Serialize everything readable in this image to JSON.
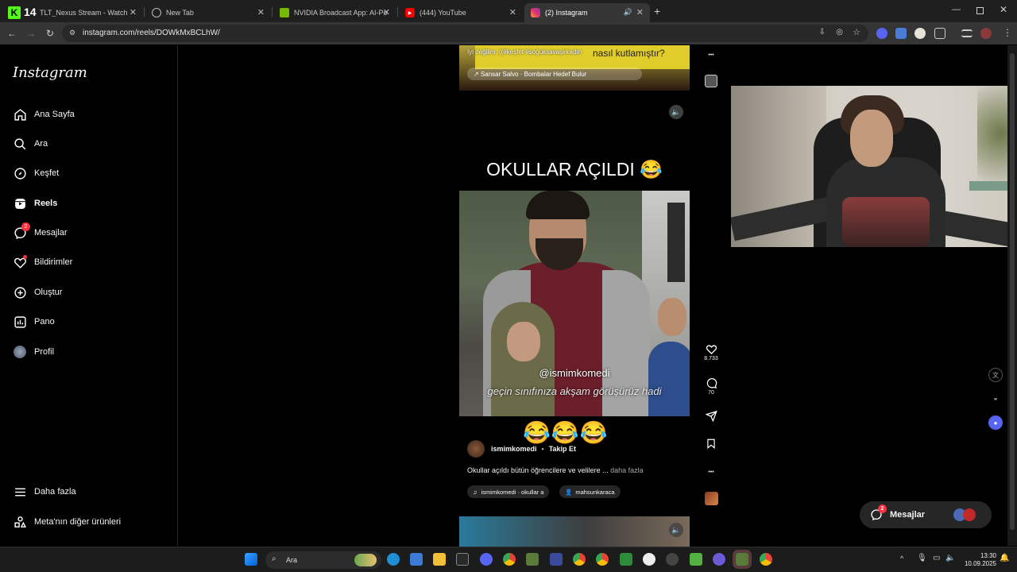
{
  "browser": {
    "tabs": [
      {
        "label": "TLT_Nexus Stream - Watch Li",
        "fav_text": "K",
        "fav_color": "#53fc18",
        "overlay_text": "14"
      },
      {
        "label": "New Tab"
      },
      {
        "label": "NVIDIA Broadcast App: AI-Pow",
        "fav_color": "#76b900"
      },
      {
        "label": "(444) YouTube",
        "fav_color": "#ff0000"
      },
      {
        "label": "(2) Instagram",
        "fav_color": "#e1306c"
      }
    ],
    "url": "instagram.com/reels/DOWkMxBCLhW/"
  },
  "sidebar": {
    "logo": "Instagram",
    "items": [
      {
        "label": "Ana Sayfa",
        "icon": "home-icon"
      },
      {
        "label": "Ara",
        "icon": "search-icon"
      },
      {
        "label": "Keşfet",
        "icon": "compass-icon"
      },
      {
        "label": "Reels",
        "icon": "reels-icon"
      },
      {
        "label": "Mesajlar",
        "icon": "messenger-icon",
        "badge": "2"
      },
      {
        "label": "Bildirimler",
        "icon": "heart-icon"
      },
      {
        "label": "Oluştur",
        "icon": "plus-square-icon"
      },
      {
        "label": "Pano",
        "icon": "dashboard-icon"
      },
      {
        "label": "Profil",
        "icon": "avatar"
      }
    ],
    "more": "Daha fazla",
    "meta": "Meta'nın diğer ürünleri"
  },
  "reel_prev": {
    "caption": "İyi değilim :((#keşfet #soğuksavaş#kadın",
    "caption_right": "nasıl kutlamıştır?",
    "music": "↗ Sansar Salvo · Bombalar Hedef Bulur"
  },
  "reel": {
    "title": "OKULLAR AÇILDI 😂",
    "video_handle": "@ismimkomedi",
    "video_subtitle": "geçin sınıfınıza akşam görüşürüz hadi",
    "emoji": "😂😂😂",
    "author": "ismimkomedi",
    "follow": "Takip Et",
    "description": "Okullar açıldı bütün öğrencilere ve velilere ...",
    "more": "daha fazla",
    "audio_chip": "ismimkomedi · okullar a",
    "tag_chip": "mahsunkaraca"
  },
  "actions": {
    "likes": "8.733",
    "comments": "70"
  },
  "messages_pill": {
    "label": "Mesajlar",
    "badge": "2"
  },
  "taskbar": {
    "search": "Ara",
    "time": "13:30",
    "date": "10.09.2025"
  },
  "colors": {
    "background": "#000000",
    "badge": "#ff3040",
    "chip": "#262626"
  }
}
